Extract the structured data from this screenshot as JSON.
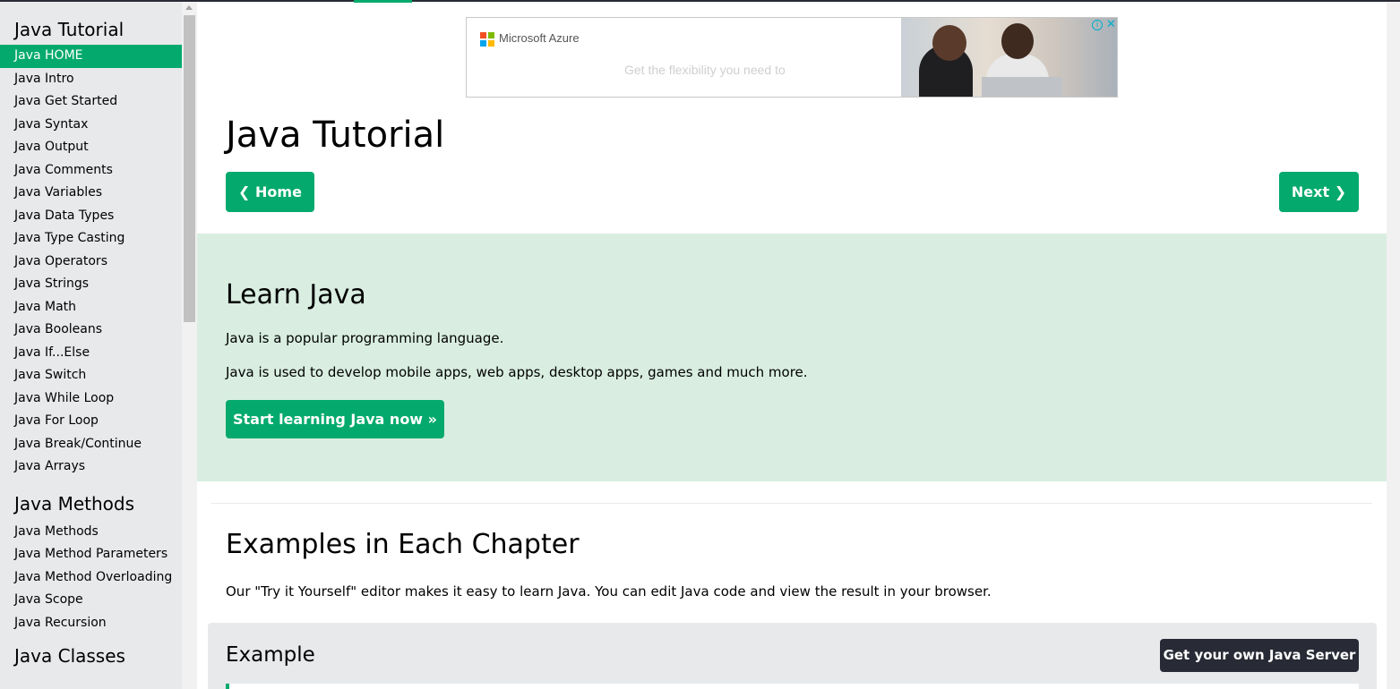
{
  "sidebar": {
    "sections": [
      {
        "heading": "Java Tutorial",
        "items": [
          {
            "label": "Java HOME",
            "active": true
          },
          {
            "label": "Java Intro"
          },
          {
            "label": "Java Get Started"
          },
          {
            "label": "Java Syntax"
          },
          {
            "label": "Java Output"
          },
          {
            "label": "Java Comments"
          },
          {
            "label": "Java Variables"
          },
          {
            "label": "Java Data Types"
          },
          {
            "label": "Java Type Casting"
          },
          {
            "label": "Java Operators"
          },
          {
            "label": "Java Strings"
          },
          {
            "label": "Java Math"
          },
          {
            "label": "Java Booleans"
          },
          {
            "label": "Java If...Else"
          },
          {
            "label": "Java Switch"
          },
          {
            "label": "Java While Loop"
          },
          {
            "label": "Java For Loop"
          },
          {
            "label": "Java Break/Continue"
          },
          {
            "label": "Java Arrays"
          }
        ]
      },
      {
        "heading": "Java Methods",
        "items": [
          {
            "label": "Java Methods"
          },
          {
            "label": "Java Method Parameters"
          },
          {
            "label": "Java Method Overloading"
          },
          {
            "label": "Java Scope"
          },
          {
            "label": "Java Recursion"
          }
        ]
      },
      {
        "heading": "Java Classes",
        "items": []
      }
    ]
  },
  "ad": {
    "brand": "Microsoft Azure",
    "tagline": "Get the flexibility you need to",
    "info_glyph": "i",
    "close_glyph": "✕",
    "logo_colors": [
      "#f25022",
      "#7fba00",
      "#00a4ef",
      "#ffb900"
    ]
  },
  "main": {
    "title": "Java Tutorial",
    "home_button": "❮ Home",
    "next_button": "Next ❯",
    "learn": {
      "heading": "Learn Java",
      "p1": "Java is a popular programming language.",
      "p2": "Java is used to develop mobile apps, web apps, desktop apps, games and much more.",
      "button": "Start learning Java now »"
    },
    "examples": {
      "heading": "Examples in Each Chapter",
      "text": "Our \"Try it Yourself\" editor makes it easy to learn Java. You can edit Java code and view the result in your browser.",
      "box_title": "Example",
      "server_button": "Get your own Java Server"
    }
  },
  "colors": {
    "accent": "#04aa6d",
    "sidebar_bg": "#e7e9eb",
    "learn_bg": "#d9eee1",
    "dark": "#282a35"
  }
}
